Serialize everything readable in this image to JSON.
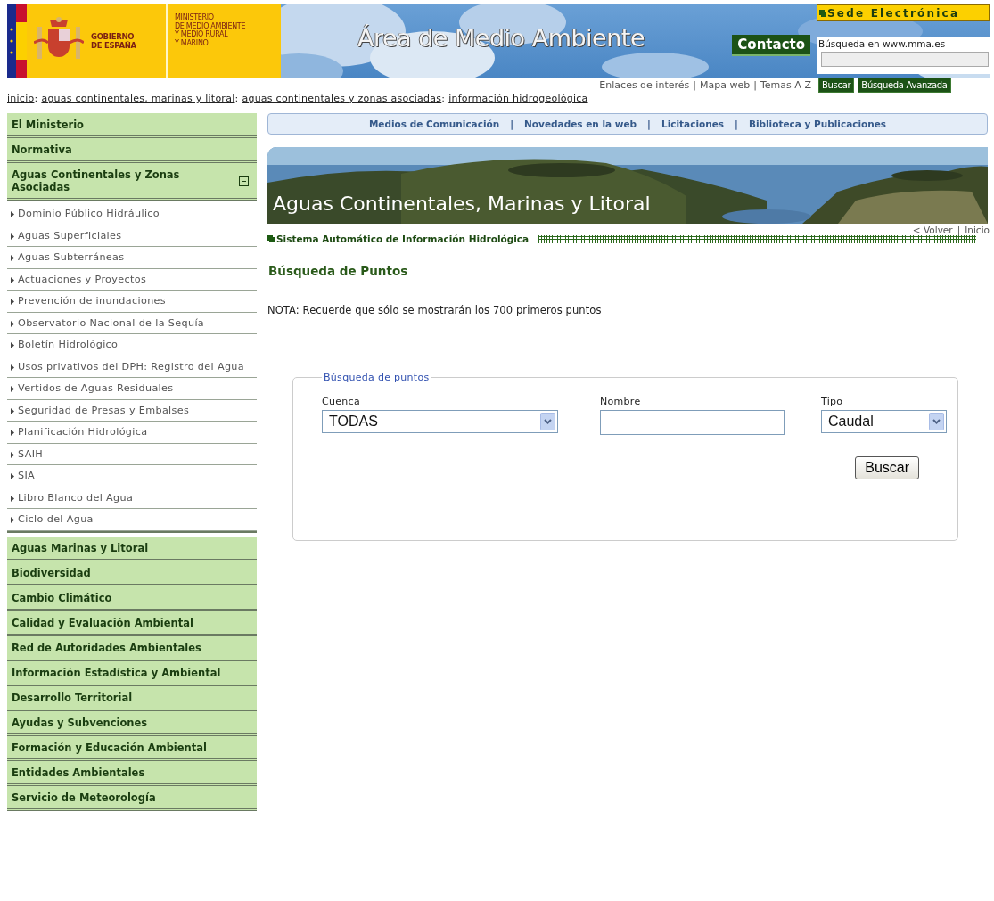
{
  "header": {
    "government_lines": [
      "GOBIERNO",
      "DE ESPAÑA"
    ],
    "ministry_lines": [
      "MINISTERIO",
      "DE MEDIO AMBIENTE",
      "Y MEDIO RURAL",
      "Y MARINO"
    ],
    "site_title": "Área de Medio Ambiente",
    "sede": "Sede Electrónica",
    "contact": "Contacto",
    "search": {
      "label": "Búsqueda en www.mma.es",
      "button": "Buscar",
      "advanced": "Búsqueda Avanzada"
    },
    "links_separator": "|",
    "links": [
      "Enlaces de interés",
      "Mapa web",
      "Temas A-Z"
    ]
  },
  "breadcrumb": {
    "separator": ":",
    "items": [
      "inicio",
      "aguas continentales, marinas y litoral",
      "aguas continentales y zonas asociadas",
      "información hidrogeológica"
    ]
  },
  "sidebar": {
    "items": [
      {
        "label": "El Ministerio",
        "expanded": false
      },
      {
        "label": "Normativa",
        "expanded": false
      },
      {
        "label": "Aguas Continentales y Zonas Asociadas",
        "expanded": true,
        "children": [
          {
            "label": "Dominio Público Hidráulico"
          },
          {
            "label": "Aguas Superficiales"
          },
          {
            "label": "Aguas Subterráneas"
          },
          {
            "label": "Actuaciones y Proyectos"
          },
          {
            "label": "Prevención de inundaciones"
          },
          {
            "label": "Observatorio Nacional de la Sequía"
          },
          {
            "label": "Boletín Hidrológico"
          },
          {
            "label": "Usos privativos del DPH: Registro del Agua"
          },
          {
            "label": "Vertidos de Aguas Residuales"
          },
          {
            "label": "Seguridad de Presas y Embalses"
          },
          {
            "label": "Planificación Hidrológica"
          },
          {
            "label": "SAIH"
          },
          {
            "label": "SIA"
          },
          {
            "label": "Libro Blanco del Agua"
          },
          {
            "label": "Ciclo del Agua"
          }
        ]
      },
      {
        "label": "Aguas Marinas y Litoral",
        "expanded": false
      },
      {
        "label": "Biodiversidad",
        "expanded": false
      },
      {
        "label": "Cambio Climático",
        "expanded": false
      },
      {
        "label": "Calidad y Evaluación Ambiental",
        "expanded": false
      },
      {
        "label": "Red de Autoridades Ambientales",
        "expanded": false
      },
      {
        "label": "Información Estadística y Ambiental",
        "expanded": false
      },
      {
        "label": "Desarrollo Territorial",
        "expanded": false
      },
      {
        "label": "Ayudas y Subvenciones",
        "expanded": false
      },
      {
        "label": "Formación y Educación Ambiental",
        "expanded": false
      },
      {
        "label": "Entidades Ambientales",
        "expanded": false
      },
      {
        "label": "Servicio de Meteorología",
        "expanded": false
      }
    ]
  },
  "nav": {
    "separator": "|",
    "items": [
      "Medios de Comunicación",
      "Novedades en la web",
      "Licitaciones",
      "Biblioteca y Publicaciones"
    ]
  },
  "banner": {
    "title": "Aguas Continentales, Marinas y Litoral"
  },
  "page_links": {
    "separator": "|",
    "items": [
      "< Volver",
      "Inicio"
    ]
  },
  "section_title": "Sistema Automático de Información Hidrológica",
  "heading": "Búsqueda de Puntos",
  "note": "NOTA: Recuerde que sólo se mostrarán los 700 primeros puntos",
  "form": {
    "legend": "Búsqueda de puntos",
    "fields": [
      {
        "kind": "select",
        "label": "Cuenca",
        "value": "TODAS"
      },
      {
        "kind": "text",
        "label": "Nombre"
      },
      {
        "kind": "select",
        "label": "Tipo",
        "value": "Caudal"
      }
    ],
    "button": "Buscar"
  }
}
